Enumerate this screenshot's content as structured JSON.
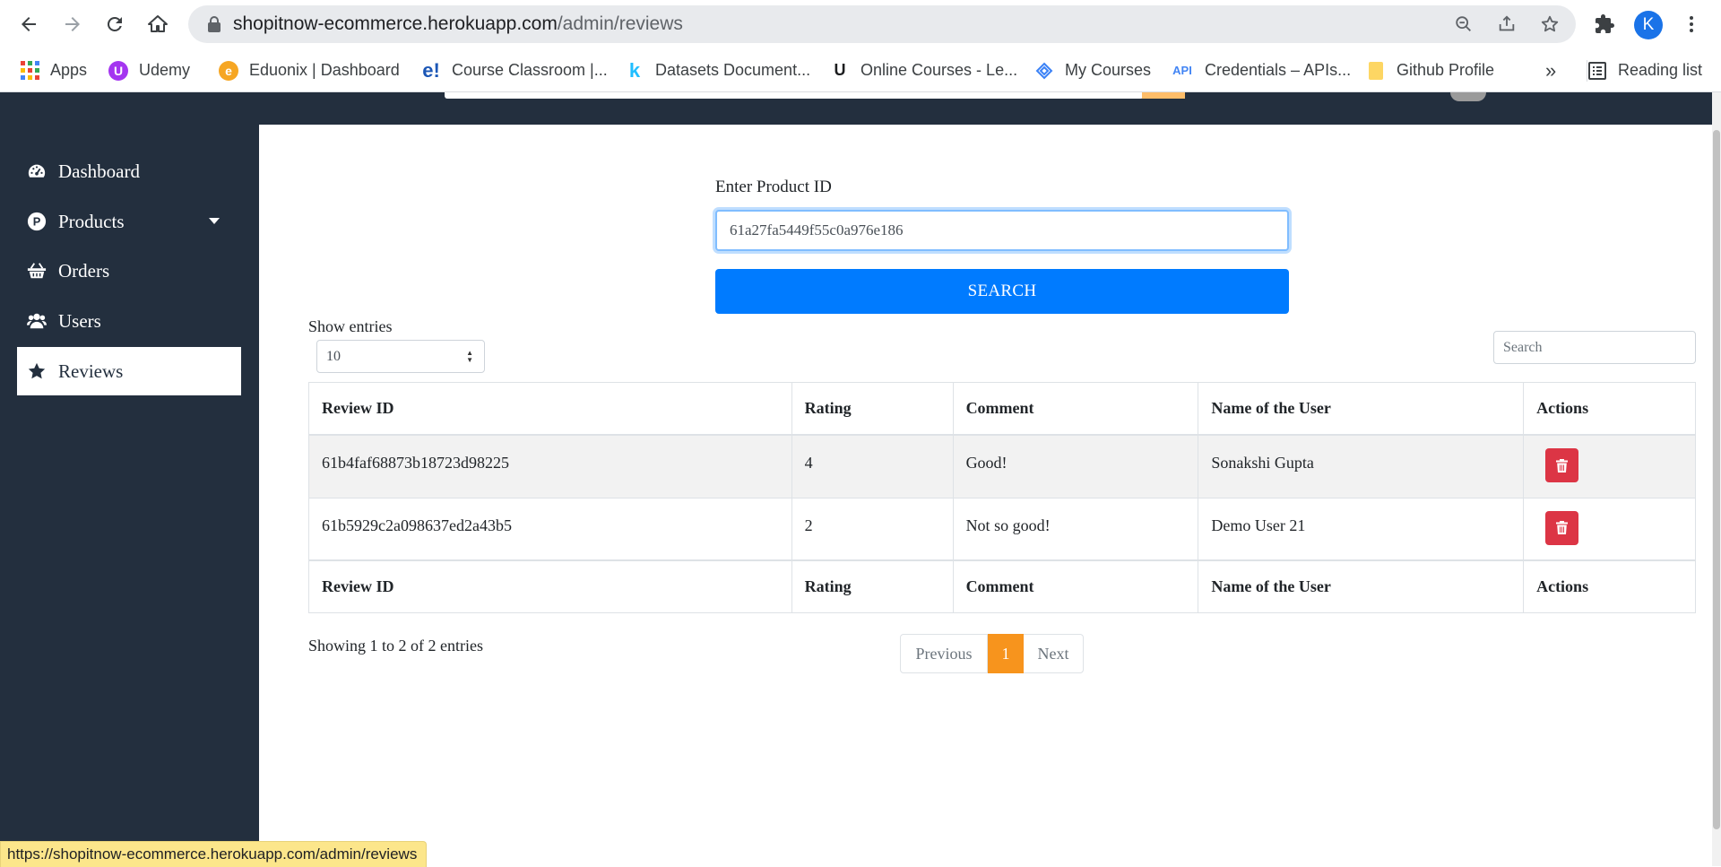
{
  "browser": {
    "url_domain": "shopitnow-ecommerce.herokuapp.com",
    "url_path": "/admin/reviews",
    "profile_initial": "K",
    "status_url": "https://shopitnow-ecommerce.herokuapp.com/admin/reviews",
    "bookmarks": [
      {
        "label": "Apps",
        "icon": "apps-grid-icon"
      },
      {
        "label": "Udemy",
        "icon": "udemy-icon"
      },
      {
        "label": "Eduonix | Dashboard",
        "icon": "eduonix-icon"
      },
      {
        "label": "Course Classroom |...",
        "icon": "e-learning-icon"
      },
      {
        "label": "Datasets Document...",
        "icon": "kaggle-icon"
      },
      {
        "label": "Online Courses - Le...",
        "icon": "udemy-u-icon"
      },
      {
        "label": "My Courses",
        "icon": "courses-icon"
      },
      {
        "label": "Credentials – APIs...",
        "icon": "api-icon"
      },
      {
        "label": "Github Profile",
        "icon": "folder-icon"
      }
    ],
    "overflow_label": "»",
    "reading_list_label": "Reading list"
  },
  "sidebar": {
    "items": [
      {
        "label": "Dashboard",
        "icon": "tachometer-icon"
      },
      {
        "label": "Products",
        "icon": "product-hunt-icon"
      },
      {
        "label": "Orders",
        "icon": "shopping-basket-icon"
      },
      {
        "label": "Users",
        "icon": "users-icon"
      },
      {
        "label": "Reviews",
        "icon": "star-icon"
      }
    ],
    "active": "Reviews"
  },
  "form": {
    "label": "Enter Product ID",
    "product_id": "61a27fa5449f55c0a976e186",
    "search_label": "SEARCH"
  },
  "table_controls": {
    "show_entries_label": "Show entries",
    "entries_value": "10",
    "search_placeholder": "Search"
  },
  "table": {
    "columns": [
      "Review ID",
      "Rating",
      "Comment",
      "Name of the User",
      "Actions"
    ],
    "rows": [
      {
        "id": "61b4faf68873b18723d98225",
        "rating": "4",
        "comment": "Good!",
        "user": "Sonakshi Gupta"
      },
      {
        "id": "61b5929c2a098637ed2a43b5",
        "rating": "2",
        "comment": "Not so good!",
        "user": "Demo User 21"
      }
    ]
  },
  "pagination": {
    "info": "Showing 1 to 2 of 2 entries",
    "previous": "Previous",
    "current": "1",
    "next": "Next"
  },
  "colors": {
    "sidebar_bg": "#232f3e",
    "primary": "#007bff",
    "danger": "#dc3545",
    "page_active": "#f7941d"
  }
}
